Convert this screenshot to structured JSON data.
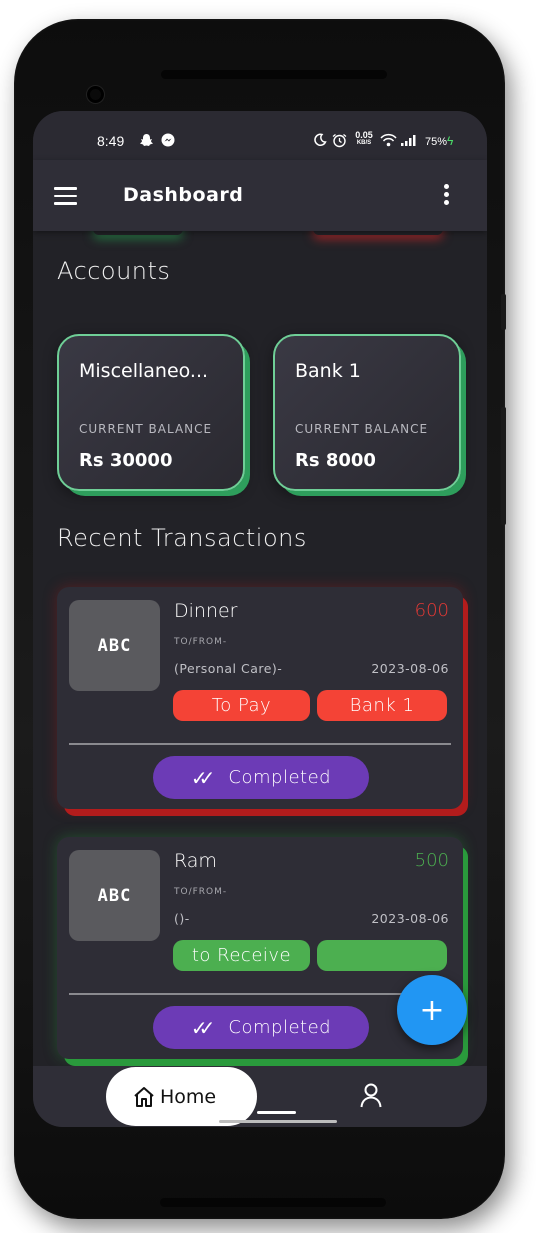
{
  "status_bar": {
    "time": "8:49",
    "net_speed": "0.05",
    "net_unit": "KB/S",
    "battery": "75%"
  },
  "app_bar": {
    "title": "Dashboard"
  },
  "accounts": {
    "section_title": "Accounts",
    "items": [
      {
        "name": "Miscellaneo...",
        "balance_label": "CURRENT BALANCE",
        "balance": "Rs 30000"
      },
      {
        "name": "Bank 1",
        "balance_label": "CURRENT BALANCE",
        "balance": "Rs 8000"
      }
    ]
  },
  "recent": {
    "section_title": "Recent Transactions",
    "items": [
      {
        "thumb": "ABC",
        "title": "Dinner",
        "amount": "600",
        "amount_color": "#e53935",
        "tofrom": "TO/FROM-",
        "category": "(Personal Care)-",
        "date": "2023-08-06",
        "type_label": "To Pay",
        "account_label": "Bank 1",
        "pill_color": "#f44336",
        "status": "Completed"
      },
      {
        "thumb": "ABC",
        "title": "Ram",
        "amount": "500",
        "amount_color": "#4caf50",
        "tofrom": "TO/FROM-",
        "category": "()-",
        "date": "2023-08-06",
        "type_label": "to Receive",
        "account_label": "",
        "pill_color": "#4caf50",
        "status": "Completed"
      }
    ]
  },
  "fab": {
    "icon": "plus-icon",
    "label": "+"
  },
  "bottom_nav": {
    "home_label": "Home",
    "home_icon": "home-icon",
    "profile_icon": "user-icon"
  },
  "colors": {
    "accent_purple": "#6c3bb6",
    "accent_blue": "#2196f3",
    "account_border": "#6fcf97"
  }
}
